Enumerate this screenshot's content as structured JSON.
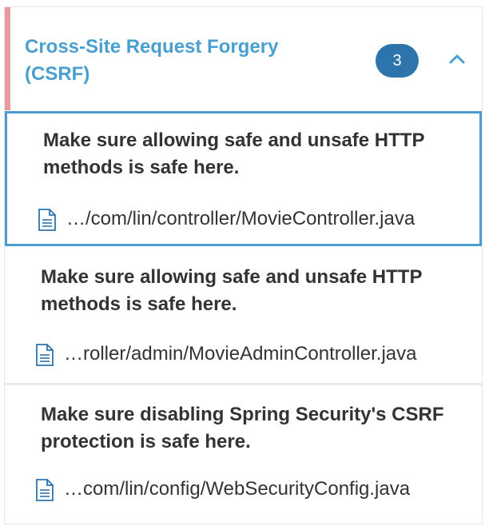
{
  "category": {
    "title": "Cross-Site Request Forgery (CSRF)",
    "count": "3",
    "expanded": true,
    "colors": {
      "accent_bar": "#e99a9e",
      "title": "#4a9fd1",
      "badge": "#2d74ac",
      "selected_border": "#4e9bd2"
    }
  },
  "issues": [
    {
      "message": "Make sure allowing safe and unsafe HTTP methods is safe here.",
      "file": "…/com/lin/controller/MovieController.java",
      "selected": true
    },
    {
      "message": "Make sure allowing safe and unsafe HTTP methods is safe here.",
      "file": "…roller/admin/MovieAdminController.java",
      "selected": false
    },
    {
      "message": "Make sure disabling Spring Security's CSRF protection is safe here.",
      "file": "…com/lin/config/WebSecurityConfig.java",
      "selected": false
    }
  ],
  "icons": {
    "file": "file-document-icon",
    "collapse": "chevron-up-icon"
  }
}
